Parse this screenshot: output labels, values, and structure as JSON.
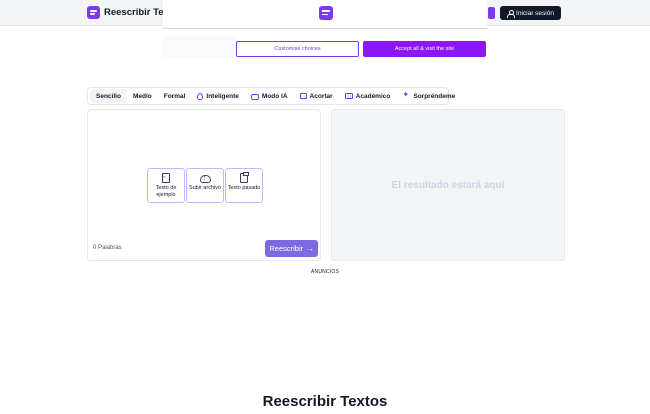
{
  "header": {
    "brand": "Reescribir Textos",
    "login_label": "Iniciar sesión"
  },
  "consent": {
    "customise_label": "Customise choices",
    "accept_label": "Accept all & visit the site"
  },
  "tabs": [
    {
      "label": "Sencillo",
      "icon": "none",
      "active": true
    },
    {
      "label": "Medio",
      "icon": "none",
      "active": false
    },
    {
      "label": "Formal",
      "icon": "none",
      "active": false
    },
    {
      "label": "Inteligente",
      "icon": "lightbulb-icon",
      "active": false
    },
    {
      "label": "Modo IA",
      "icon": "robot-icon",
      "active": false
    },
    {
      "label": "Acortar",
      "icon": "shorten-icon",
      "active": false
    },
    {
      "label": "Académico",
      "icon": "academic-icon",
      "active": false
    },
    {
      "label": "Sorpréndeme",
      "icon": "sparkle-icon",
      "active": false
    }
  ],
  "editor": {
    "options": [
      {
        "label": "Texto de ejemplo",
        "icon": "document-import-icon"
      },
      {
        "label": "Subir archivo",
        "icon": "cloud-upload-icon"
      },
      {
        "label": "Texto pasado",
        "icon": "clipboard-icon"
      }
    ],
    "word_count": "0 Palabras",
    "rewrite_label": "Reescribir",
    "rewrite_arrow": "→"
  },
  "output": {
    "placeholder": "El resultado estará aquí"
  },
  "ads_label": "ANUNCIOS",
  "section_title": "Reescribir Textos",
  "colors": {
    "accent": "#7c3aed",
    "button": "#7c6be0",
    "accept": "#8b17f5",
    "login_bg": "#111827"
  }
}
